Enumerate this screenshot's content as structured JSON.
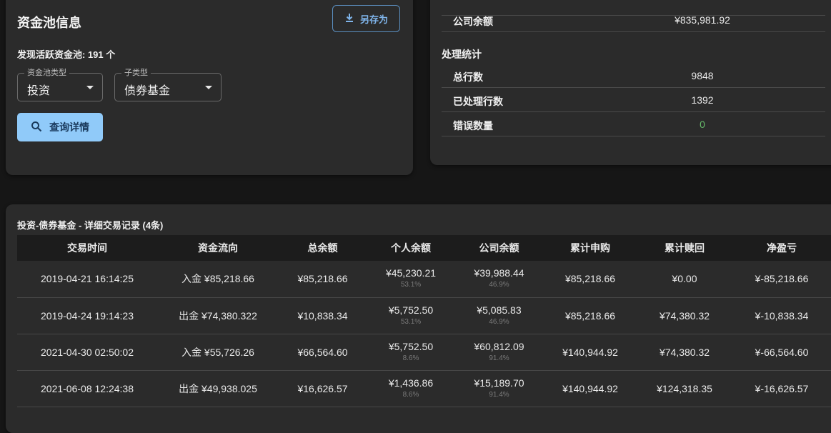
{
  "pool": {
    "title": "资金池信息",
    "save_label": "另存为",
    "found_text": "发现活跃资金池: 191 个",
    "type_select": {
      "label": "资金池类型",
      "value": "投资"
    },
    "subtype_select": {
      "label": "子类型",
      "value": "债券基金"
    },
    "query_label": "查询详情"
  },
  "stats": {
    "company_balance_label": "公司余额",
    "company_balance_value": "¥835,981.92",
    "section_title": "处理统计",
    "rows": [
      {
        "label": "总行数",
        "value": "9848"
      },
      {
        "label": "已处理行数",
        "value": "1392"
      },
      {
        "label": "错误数量",
        "value": "0"
      }
    ],
    "error_color": "#66bb6a"
  },
  "table": {
    "title": "投资-债券基金 - 详细交易记录 (4条)",
    "headers": [
      "交易时间",
      "资金流向",
      "总余额",
      "个人余额",
      "公司余额",
      "累计申购",
      "累计赎回",
      "净盈亏"
    ],
    "rows": [
      {
        "time": "2019-04-21 16:14:25",
        "flow": "入金 ¥85,218.66",
        "total": "¥85,218.66",
        "personal": "¥45,230.21",
        "personal_pct": "53.1%",
        "company": "¥39,988.44",
        "company_pct": "46.9%",
        "subscribe": "¥85,218.66",
        "redeem": "¥0.00",
        "pnl": "¥-85,218.66"
      },
      {
        "time": "2019-04-24 19:14:23",
        "flow": "出金 ¥74,380.322",
        "total": "¥10,838.34",
        "personal": "¥5,752.50",
        "personal_pct": "53.1%",
        "company": "¥5,085.83",
        "company_pct": "46.9%",
        "subscribe": "¥85,218.66",
        "redeem": "¥74,380.32",
        "pnl": "¥-10,838.34"
      },
      {
        "time": "2021-04-30 02:50:02",
        "flow": "入金 ¥55,726.26",
        "total": "¥66,564.60",
        "personal": "¥5,752.50",
        "personal_pct": "8.6%",
        "company": "¥60,812.09",
        "company_pct": "91.4%",
        "subscribe": "¥140,944.92",
        "redeem": "¥74,380.32",
        "pnl": "¥-66,564.60"
      },
      {
        "time": "2021-06-08 12:24:38",
        "flow": "出金 ¥49,938.025",
        "total": "¥16,626.57",
        "personal": "¥1,436.86",
        "personal_pct": "8.6%",
        "company": "¥15,189.70",
        "company_pct": "91.4%",
        "subscribe": "¥140,944.92",
        "redeem": "¥124,318.35",
        "pnl": "¥-16,626.57"
      }
    ]
  }
}
